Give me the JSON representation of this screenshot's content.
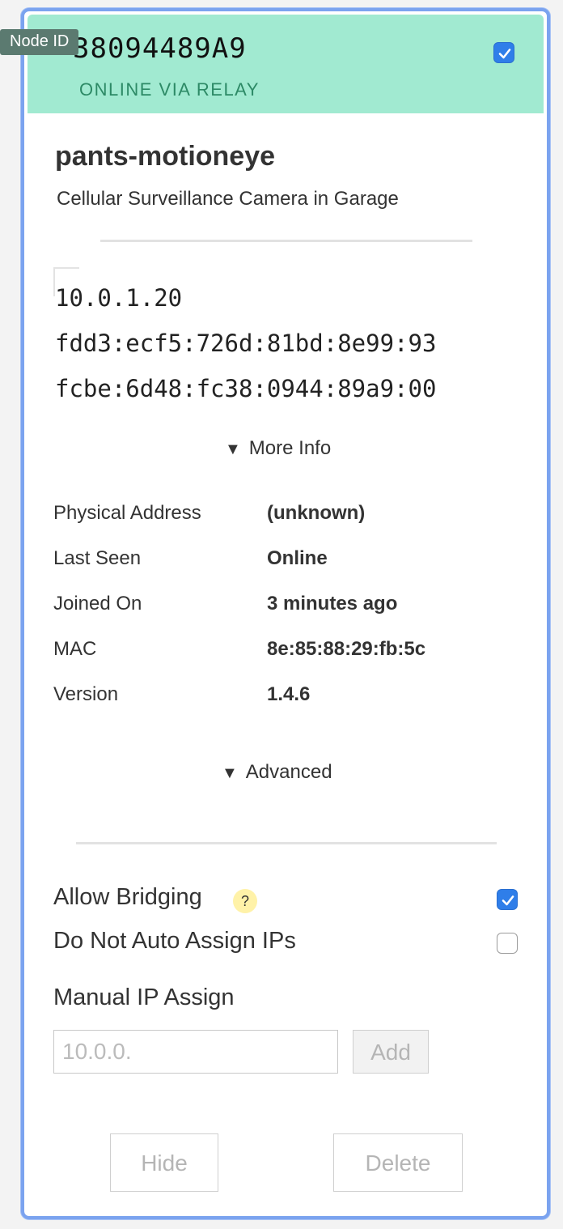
{
  "tooltip": "Node ID",
  "header": {
    "node_id": "38094489A9",
    "status": "ONLINE VIA RELAY",
    "selected": true
  },
  "node": {
    "name": "pants-motioneye",
    "description": "Cellular Surveillance Camera in Garage"
  },
  "ips": [
    "10.0.1.20",
    "fdd3:ecf5:726d:81bd:8e99:93",
    "fcbe:6d48:fc38:0944:89a9:00"
  ],
  "more_info": {
    "toggle_label": "More Info",
    "rows": [
      {
        "label": "Physical Address",
        "value": "(unknown)"
      },
      {
        "label": "Last Seen",
        "value": "Online"
      },
      {
        "label": "Joined On",
        "value": "3 minutes ago"
      },
      {
        "label": "MAC",
        "value": "8e:85:88:29:fb:5c"
      },
      {
        "label": "Version",
        "value": "1.4.6"
      }
    ]
  },
  "advanced": {
    "toggle_label": "Advanced"
  },
  "options": {
    "allow_bridging": {
      "label": "Allow Bridging",
      "help": "?",
      "checked": true
    },
    "no_auto_assign": {
      "label": "Do Not Auto Assign IPs",
      "checked": false
    }
  },
  "manual_ip": {
    "label": "Manual IP Assign",
    "placeholder": "10.0.0.",
    "add_label": "Add"
  },
  "actions": {
    "hide_label": "Hide",
    "delete_label": "Delete"
  },
  "colors": {
    "header_bg": "#a1ead1",
    "accent": "#2f7ee9",
    "border": "#7ba3ef",
    "status_text": "#2d8a66"
  }
}
